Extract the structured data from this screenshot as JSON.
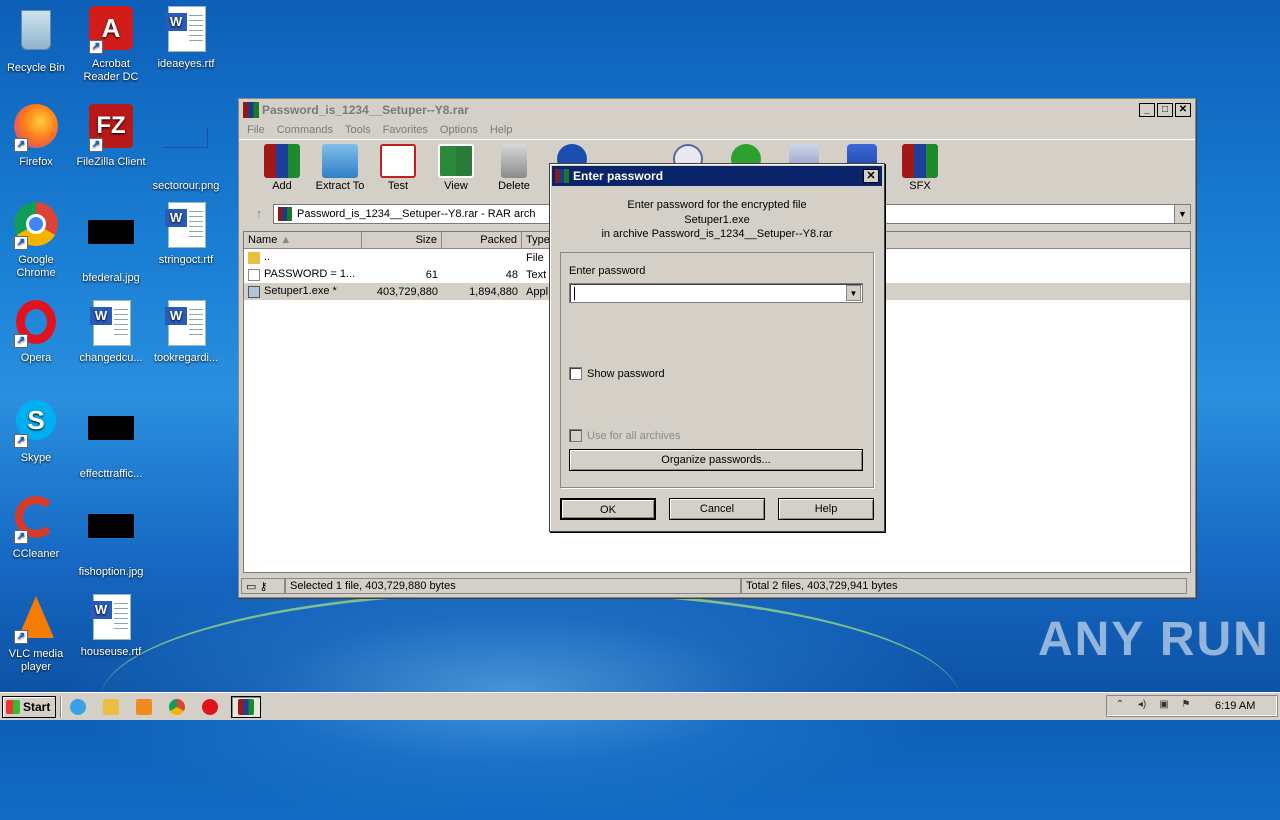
{
  "desktop": {
    "icons": [
      {
        "label": "Recycle Bin"
      },
      {
        "label": "Acrobat Reader DC"
      },
      {
        "label": "ideaeyes.rtf"
      },
      {
        "label": "Firefox"
      },
      {
        "label": "FileZilla Client"
      },
      {
        "label": "sectorour.png"
      },
      {
        "label": "Google Chrome"
      },
      {
        "label": "bfederal.jpg"
      },
      {
        "label": "stringoct.rtf"
      },
      {
        "label": "Opera"
      },
      {
        "label": "changedcu..."
      },
      {
        "label": "tookregardi..."
      },
      {
        "label": "Skype"
      },
      {
        "label": "effecttraffic..."
      },
      {
        "label": "CCleaner"
      },
      {
        "label": "fishoption.jpg"
      },
      {
        "label": "VLC media player"
      },
      {
        "label": "houseuse.rtf"
      }
    ],
    "watermark": "ANY RUN"
  },
  "winrar": {
    "title": "Password_is_1234__Setuper--Y8.rar",
    "menu": [
      "File",
      "Commands",
      "Tools",
      "Favorites",
      "Options",
      "Help"
    ],
    "toolbar": [
      {
        "label": "Add",
        "icon": "add-icon"
      },
      {
        "label": "Extract To",
        "icon": "extract-icon"
      },
      {
        "label": "Test",
        "icon": "test-icon"
      },
      {
        "label": "View",
        "icon": "view-icon"
      },
      {
        "label": "Delete",
        "icon": "delete-icon"
      },
      {
        "label": "SFX",
        "icon": "sfx-icon"
      }
    ],
    "address": "Password_is_1234__Setuper--Y8.rar - RAR arch",
    "columns": {
      "name": "Name",
      "size": "Size",
      "packed": "Packed",
      "type": "Type"
    },
    "files": [
      {
        "name": "..",
        "size": "",
        "packed": "",
        "type": "File"
      },
      {
        "name": "PASSWORD = 1...",
        "size": "61",
        "packed": "48",
        "type": "Text"
      },
      {
        "name": "Setuper1.exe *",
        "size": "403,729,880",
        "packed": "1,894,880",
        "type": "Appl"
      }
    ],
    "status_left": "Selected 1 file, 403,729,880 bytes",
    "status_right": "Total 2 files, 403,729,941 bytes"
  },
  "dialog": {
    "title": "Enter password",
    "msg_line1": "Enter password for the encrypted file",
    "msg_line2": "Setuper1.exe",
    "msg_line3": "in archive Password_is_1234__Setuper--Y8.rar",
    "field_label": "Enter password",
    "password_value": "",
    "show_password": "Show password",
    "use_for_all": "Use for all archives",
    "organize": "Organize passwords...",
    "ok": "OK",
    "cancel": "Cancel",
    "help": "Help"
  },
  "taskbar": {
    "start": "Start",
    "clock": "6:19 AM"
  }
}
